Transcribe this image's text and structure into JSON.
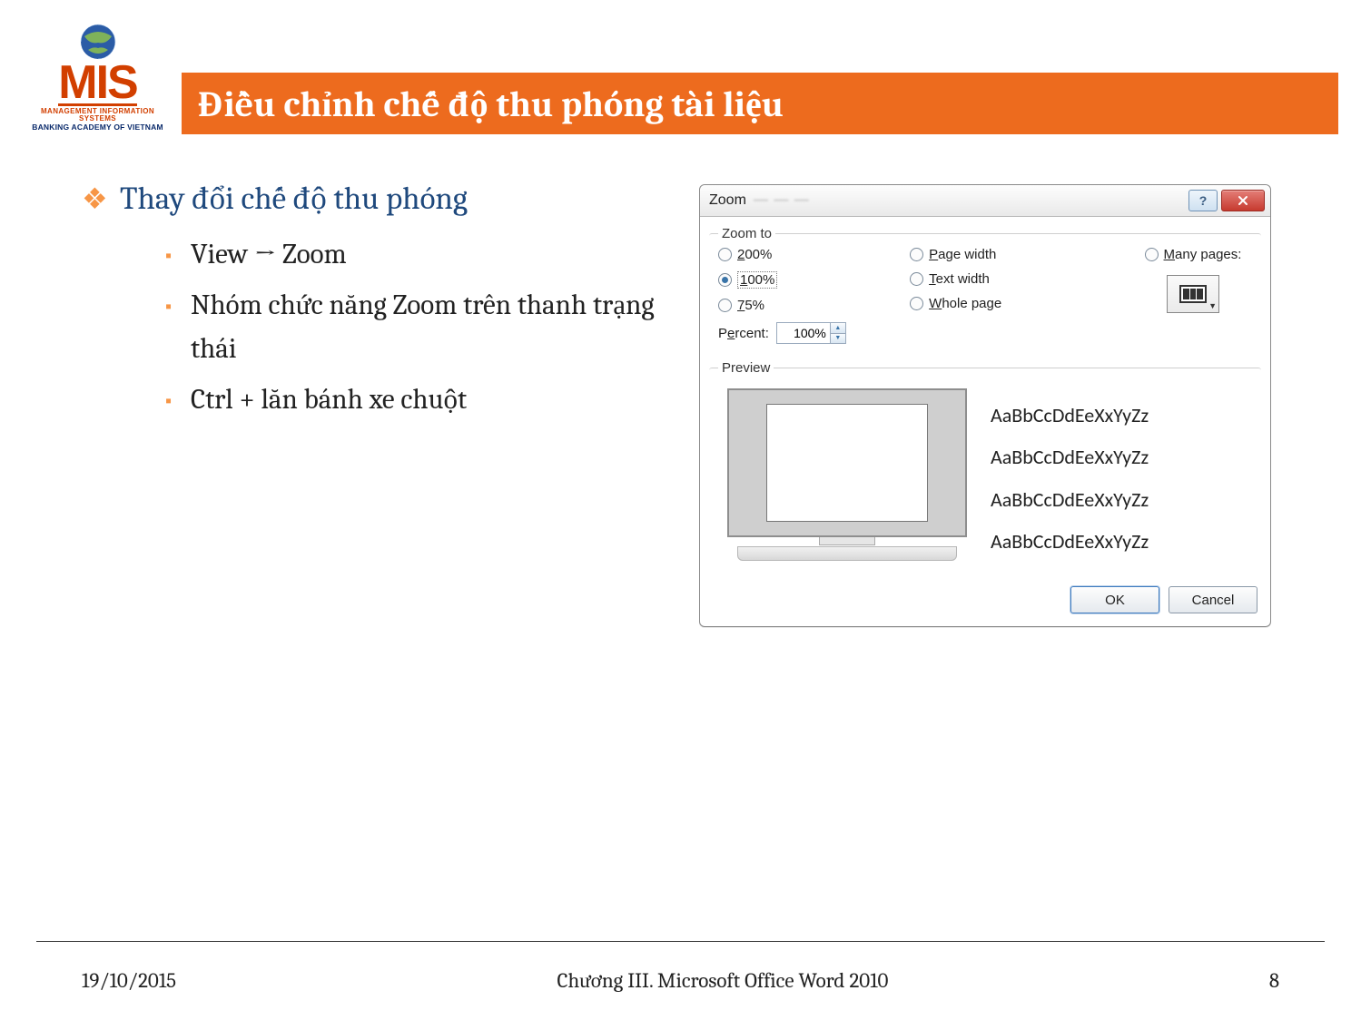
{
  "slide": {
    "title": "Điều chỉnh chế độ thu phóng  tài liệu",
    "logo": {
      "acronym": "MIS",
      "line1": "MANAGEMENT INFORMATION SYSTEMS",
      "line2": "BANKING ACADEMY OF VIETNAM"
    },
    "bullet_l1": "Thay đổi chế độ thu phóng",
    "bullets_l2": [
      "View → Zoom",
      "Nhóm chức năng Zoom trên thanh trạng thái",
      "Ctrl + lăn bánh xe chuột"
    ]
  },
  "dialog": {
    "title": "Zoom",
    "group_zoomto": "Zoom to",
    "radios_left": [
      "200%",
      "100%",
      "75%"
    ],
    "radios_mid": [
      "Page width",
      "Text width",
      "Whole page"
    ],
    "many_label": "Many pages:",
    "percent_label": "Percent:",
    "percent_value": "100%",
    "group_preview": "Preview",
    "sample": "AaBbCcDdEeXxYyZz",
    "ok": "OK",
    "cancel": "Cancel"
  },
  "footer": {
    "date": "19/10/2015",
    "chapter": "Chương III. Microsoft Office Word 2010",
    "page": "8"
  }
}
